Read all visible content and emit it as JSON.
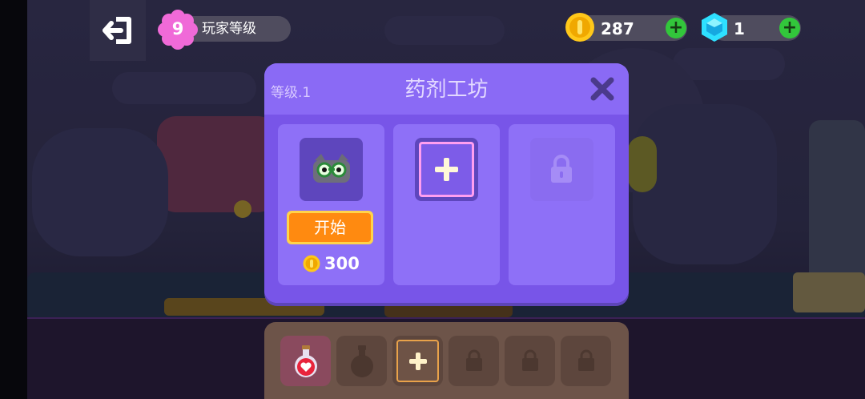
{
  "player": {
    "level": "9",
    "level_label": "玩家等级"
  },
  "currency": {
    "coins": "287",
    "gems": "1",
    "coin_color": "#ffc81a",
    "gem_color": "#2ee0ff"
  },
  "dialog": {
    "level_text": "等级.1",
    "title": "药剂工坊",
    "start_label": "开始",
    "cost": "300",
    "slots": [
      {
        "state": "ready",
        "icon": "cat-mask-icon"
      },
      {
        "state": "add",
        "icon": "plus-icon"
      },
      {
        "state": "locked",
        "icon": "lock-icon"
      }
    ]
  },
  "inventory": {
    "slots": [
      {
        "state": "potion",
        "icon": "heart-potion-icon"
      },
      {
        "state": "empty",
        "icon": "flask-silhouette-icon"
      },
      {
        "state": "add",
        "icon": "plus-icon"
      },
      {
        "state": "locked",
        "icon": "lock-icon"
      },
      {
        "state": "locked",
        "icon": "lock-icon"
      },
      {
        "state": "locked",
        "icon": "lock-icon"
      }
    ]
  },
  "colors": {
    "accent_purple": "#8c6cf6",
    "start_orange": "#ff8a10",
    "add_green": "#32c63b"
  }
}
